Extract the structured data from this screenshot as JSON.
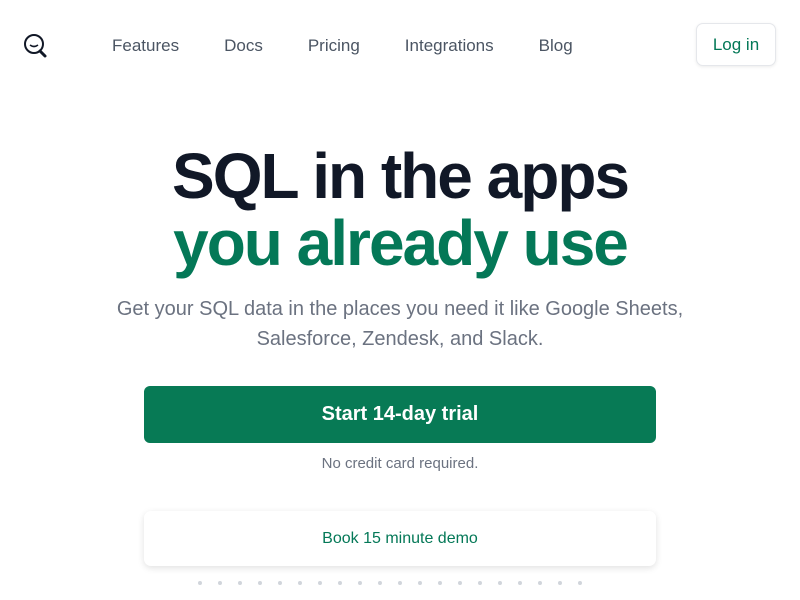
{
  "nav": {
    "logo_icon": "search-face-icon",
    "links": [
      "Features",
      "Docs",
      "Pricing",
      "Integrations",
      "Blog"
    ],
    "login_label": "Log in"
  },
  "hero": {
    "line1": "SQL in the apps",
    "line2": "you already use",
    "subtitle": "Get your SQL data in the places you need it like Google Sheets, Salesforce, Zendesk, and Slack.",
    "cta_label": "Start 14-day trial",
    "note": "No credit card required.",
    "demo_label": "Book 15 minute demo"
  },
  "colors": {
    "brand_green": "#077a55",
    "heading_dark": "#111827",
    "muted_text": "#6b7280"
  }
}
